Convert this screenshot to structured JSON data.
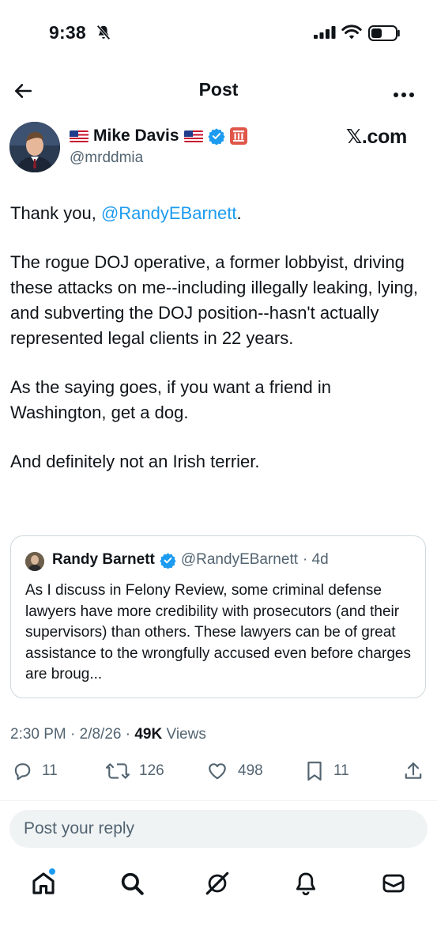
{
  "status_bar": {
    "time": "9:38"
  },
  "header": {
    "title": "Post"
  },
  "author": {
    "name": "Mike Davis",
    "handle": "@mrddmia",
    "brand": "𝕏.com"
  },
  "post": {
    "intro_text": "Thank you, ",
    "mention": "@RandyEBarnett",
    "intro_end": ".",
    "paragraph_2": "The rogue DOJ operative, a former lobbyist, driving these attacks on me--including illegally leaking, lying, and subverting the DOJ position--hasn't actually represented legal clients in 22 years.",
    "paragraph_3": "As the saying goes, if you want a friend in Washington, get a dog.",
    "paragraph_4": "And definitely not an Irish terrier."
  },
  "quote": {
    "name": "Randy Barnett",
    "handle": "@RandyEBarnett",
    "age": "· 4d",
    "text": "As I discuss in Felony Review, some criminal defense lawyers have more credibility with prosecutors (and their supervisors) than others. These lawyers can be of great assistance to the wrongfully accused even before charges are broug..."
  },
  "meta": {
    "timestamp": "2:30 PM · 2/8/26 · ",
    "views_count": "49K",
    "views_label": " Views"
  },
  "actions": {
    "replies": "11",
    "reposts": "126",
    "likes": "498",
    "bookmarks": "11"
  },
  "reply": {
    "placeholder": "Post your reply"
  },
  "colors": {
    "accent": "#1d9bf0",
    "secondary_text": "#536471",
    "affiliation_badge": "#e0574a"
  },
  "icons": [
    "bell-slash-icon",
    "signal-icon",
    "wifi-icon",
    "battery-icon",
    "back-arrow-icon",
    "more-icon",
    "verified-icon",
    "affiliation-icon",
    "reply-icon",
    "repost-icon",
    "like-icon",
    "bookmark-icon",
    "share-icon",
    "home-icon",
    "search-icon",
    "grok-icon",
    "notifications-icon",
    "messages-icon"
  ]
}
